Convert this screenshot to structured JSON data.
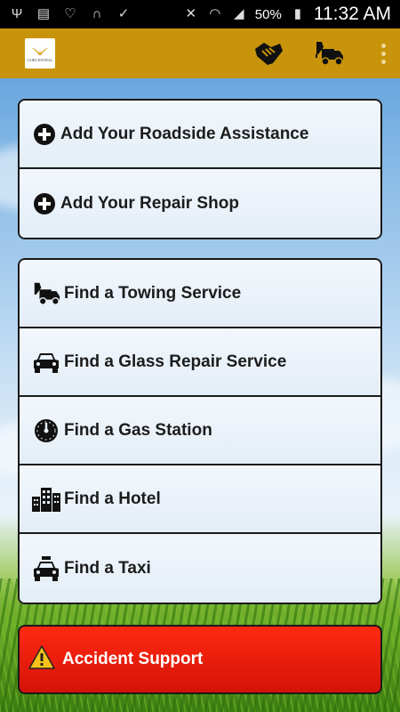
{
  "status_bar": {
    "battery_percent": "50%",
    "time": "11:32 AM"
  },
  "app_bar": {
    "logo_text": "1AIRCENTRAL",
    "actions": [
      "handshake-icon",
      "tow-truck-icon",
      "overflow-menu-icon"
    ]
  },
  "my_services": [
    {
      "label": "Add Your Roadside Assistance",
      "icon": "plus-circle-icon"
    },
    {
      "label": "Add Your Repair Shop",
      "icon": "plus-circle-icon"
    }
  ],
  "find_services": [
    {
      "label": "Find a Towing Service",
      "icon": "tow-truck-icon"
    },
    {
      "label": "Find a Glass Repair Service",
      "icon": "car-icon"
    },
    {
      "label": "Find a Gas Station",
      "icon": "gauge-icon"
    },
    {
      "label": "Find a Hotel",
      "icon": "buildings-icon"
    },
    {
      "label": "Find a Taxi",
      "icon": "taxi-icon"
    }
  ],
  "accident": {
    "label": "Accident Support",
    "icon": "warning-icon"
  },
  "colors": {
    "app_bar": "#c8940b",
    "accident_button": "#e81c0c",
    "menu_item_bg": "#e9f1fa"
  }
}
